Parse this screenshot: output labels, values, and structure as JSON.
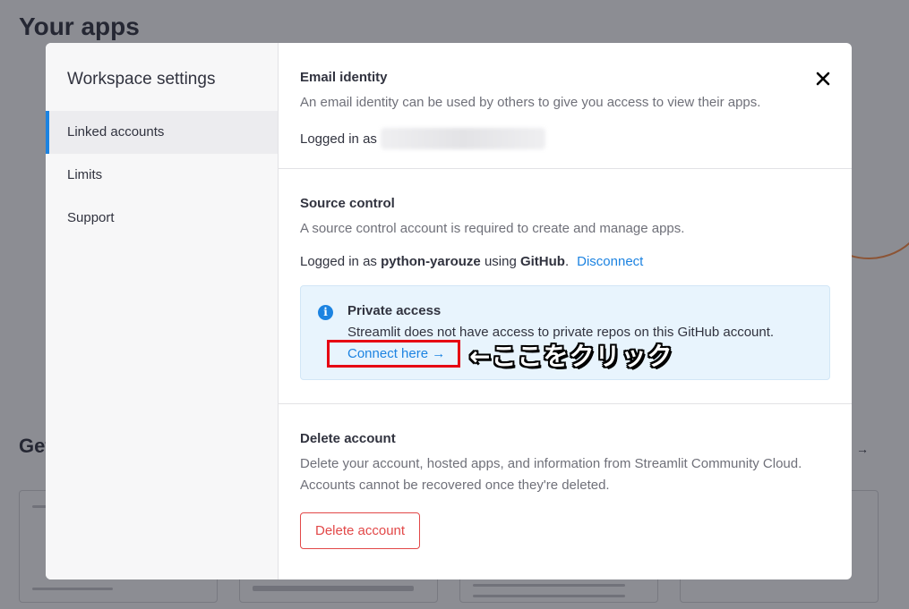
{
  "background": {
    "title": "Your apps",
    "section_partial": "Get",
    "arrow": "→"
  },
  "sidebar": {
    "title": "Workspace settings",
    "items": [
      {
        "label": "Linked accounts",
        "active": true
      },
      {
        "label": "Limits",
        "active": false
      },
      {
        "label": "Support",
        "active": false
      }
    ]
  },
  "email_identity": {
    "title": "Email identity",
    "description": "An email identity can be used by others to give you access to view their apps.",
    "logged_in_prefix": "Logged in as"
  },
  "source_control": {
    "title": "Source control",
    "description": "A source control account is required to create and manage apps.",
    "logged_in_prefix": "Logged in as",
    "username": "python-yarouze",
    "using": "using",
    "provider": "GitHub",
    "period": ".",
    "disconnect_label": "Disconnect",
    "info": {
      "icon": "i",
      "title": "Private access",
      "text": "Streamlit does not have access to private repos on this GitHub account.",
      "connect_label": "Connect here →"
    },
    "annotation": "←ここをクリック"
  },
  "delete_account": {
    "title": "Delete account",
    "description_line1": "Delete your account, hosted apps, and information from Streamlit Community Cloud.",
    "description_line2": "Accounts cannot be recovered once they're deleted.",
    "button_label": "Delete account"
  },
  "colors": {
    "accent": "#1c83e1",
    "danger": "#e24848",
    "highlight": "#e60012"
  }
}
